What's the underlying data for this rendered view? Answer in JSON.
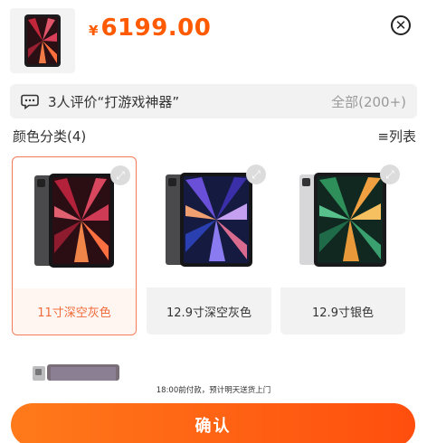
{
  "header": {
    "currency": "¥",
    "price": "6199.00"
  },
  "review": {
    "text": "3人评价“打游戏神器”",
    "all_label": "全部(200+)"
  },
  "section": {
    "title": "颜色分类(4)",
    "mode": "≡列表"
  },
  "options": [
    {
      "label": "11寸深空灰色",
      "selected": true
    },
    {
      "label": "12.9寸深空灰色",
      "selected": false
    },
    {
      "label": "12.9寸银色",
      "selected": false
    }
  ],
  "notice": "18:00前付款，预计明天送货上门",
  "confirm_label": "确认",
  "colors": {
    "accent": "#ff5a00",
    "selected_border": "#f27a55",
    "label_bg": "#f2f2f2"
  }
}
